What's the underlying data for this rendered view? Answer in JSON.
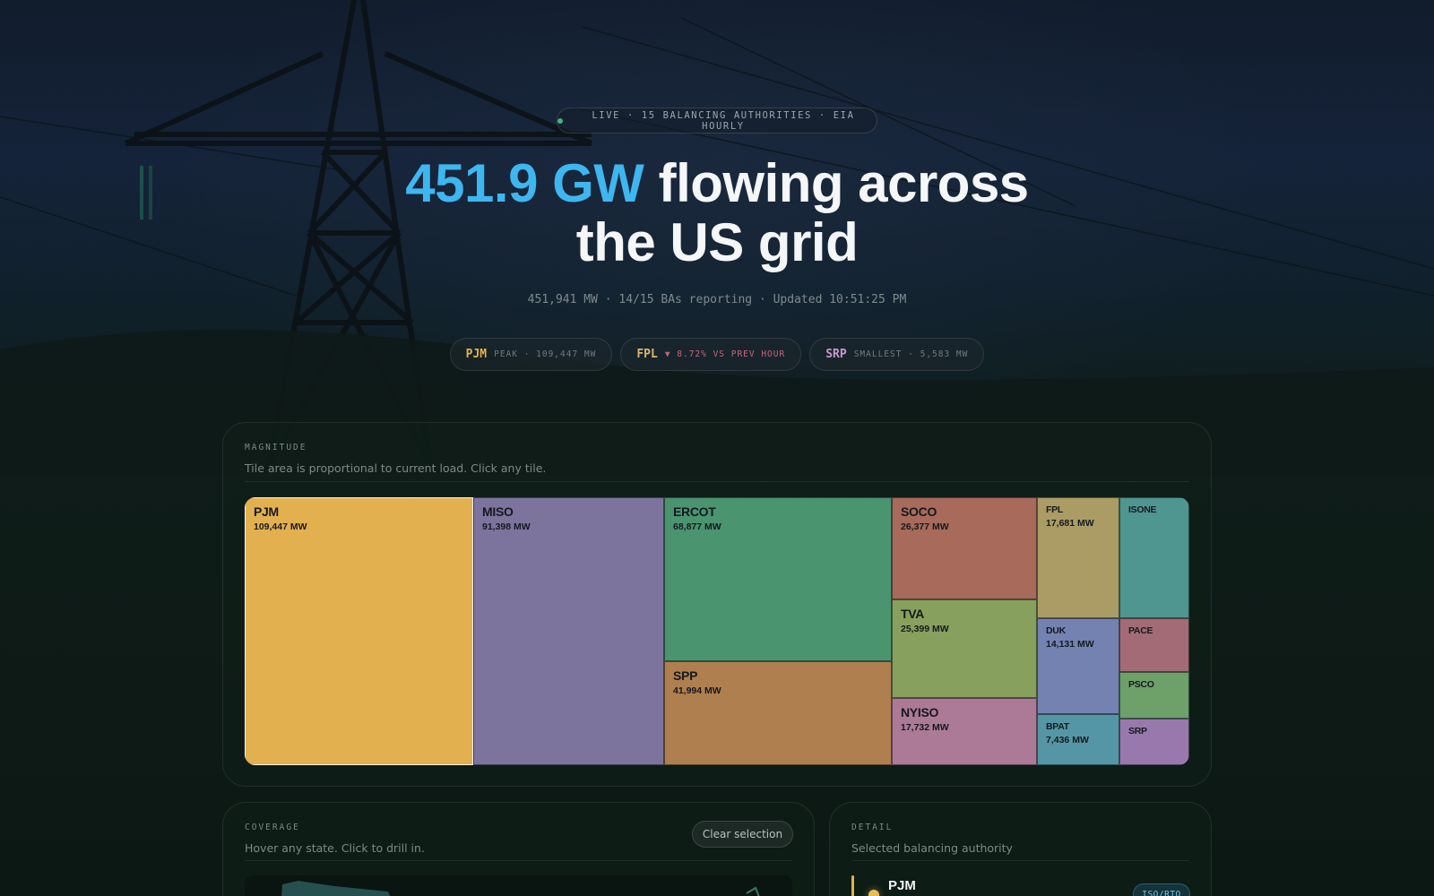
{
  "hero": {
    "live_pill": "LIVE · 15 BALANCING AUTHORITIES · EIA HOURLY",
    "headline_accent": "451.9 GW",
    "headline_line1_rest": " flowing across",
    "headline_line2": "the US grid",
    "subline": "451,941 MW · 14/15 BAs reporting · Updated 10:51:25 PM",
    "stats": [
      {
        "code": "PJM",
        "note": "PEAK · 109,447 MW",
        "code_color": "#e3b04f",
        "note_color": "#6f7b80"
      },
      {
        "code": "FPL",
        "note": "▼ 8.72% VS PREV HOUR",
        "code_color": "#d9b56e",
        "note_color": "#c8647c"
      },
      {
        "code": "SRP",
        "note": "SMALLEST · 5,583 MW",
        "code_color": "#c79ad0",
        "note_color": "#6f7b80"
      }
    ]
  },
  "magnitude": {
    "kicker": "MAGNITUDE",
    "description": "Tile area is proportional to current load. Click any tile.",
    "selected": "PJM",
    "tiles": [
      {
        "id": "PJM",
        "value": "109,447 MW",
        "color": "#e3b04f"
      },
      {
        "id": "MISO",
        "value": "91,398 MW",
        "color": "#7d749d"
      },
      {
        "id": "ERCOT",
        "value": "68,877 MW",
        "color": "#4b9470"
      },
      {
        "id": "SPP",
        "value": "41,994 MW",
        "color": "#af7f4f"
      },
      {
        "id": "SOCO",
        "value": "26,377 MW",
        "color": "#a86a5a"
      },
      {
        "id": "TVA",
        "value": "25,399 MW",
        "color": "#88a05d"
      },
      {
        "id": "NYISO",
        "value": "17,732 MW",
        "color": "#ac7a97"
      },
      {
        "id": "FPL",
        "value": "17,681 MW",
        "color": "#aa9c64"
      },
      {
        "id": "ISONE",
        "value": "",
        "color": "#4f9690"
      },
      {
        "id": "DUK",
        "value": "14,131 MW",
        "color": "#7482b1"
      },
      {
        "id": "PACE",
        "value": "",
        "color": "#a36b75"
      },
      {
        "id": "PSCO",
        "value": "",
        "color": "#6ea06a"
      },
      {
        "id": "BPAT",
        "value": "7,436 MW",
        "color": "#5496a6"
      },
      {
        "id": "SRP",
        "value": "",
        "color": "#9979ad"
      }
    ]
  },
  "coverage": {
    "kicker": "COVERAGE",
    "description": "Hover any state. Click to drill in.",
    "clear_button": "Clear selection"
  },
  "detail": {
    "kicker": "DETAIL",
    "description": "Selected balancing authority",
    "name": "PJM",
    "badge": "ISO/RTO",
    "accent_color": "#e2b04f"
  }
}
